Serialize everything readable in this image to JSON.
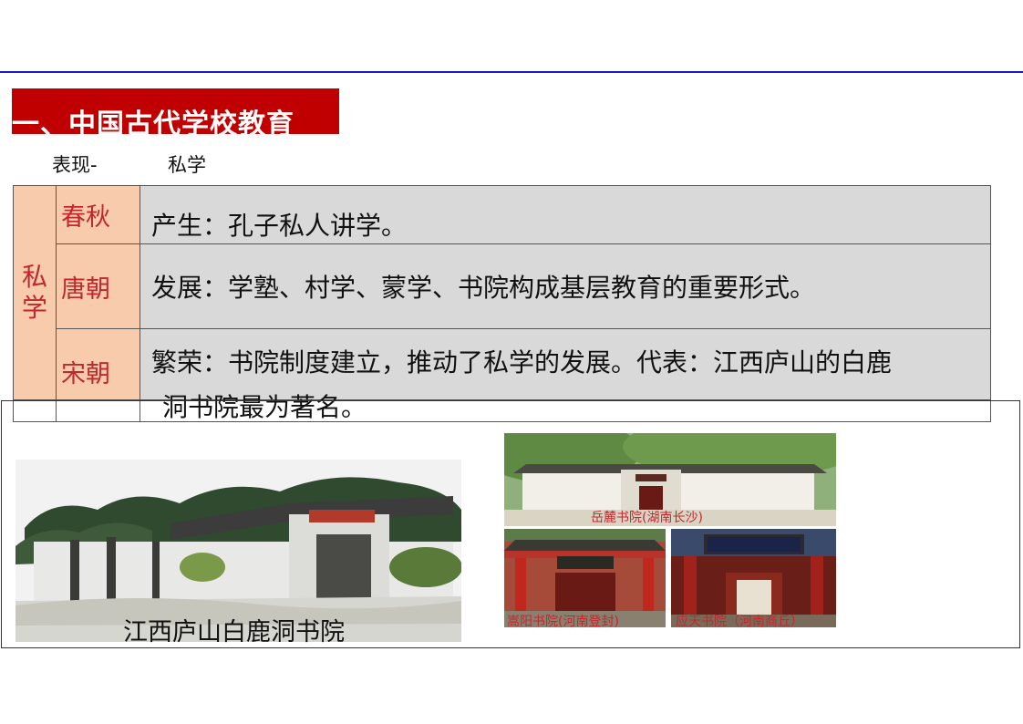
{
  "header": {
    "title": "一、中国古代学校教育"
  },
  "subhead": {
    "label": "表现-",
    "value": "私学"
  },
  "table": {
    "category": "私学",
    "rows": [
      {
        "era": "春秋",
        "desc": "产生：孔子私人讲学。"
      },
      {
        "era": "唐朝",
        "desc": "发展：学塾、村学、蒙学、书院构成基层教育的重要形式。"
      },
      {
        "era": "宋朝",
        "desc_line1": "繁荣：书院制度建立，推动了私学的发展。代表：江西庐山的白鹿",
        "desc_line2": "洞书院最为著名。"
      }
    ]
  },
  "images": {
    "bailudong": {
      "caption": "江西庐山白鹿洞书院"
    },
    "yuelu": {
      "caption": "岳麓书院(湖南长沙)"
    },
    "songyang": {
      "caption": "嵩阳书院(河南登封)"
    },
    "yingtian": {
      "caption": "应天书院（河南商丘）"
    }
  },
  "colors": {
    "title_bg": "#c00000",
    "era_bg": "#f8cbad",
    "era_text": "#c0282d",
    "desc_bg": "#d9d9d9",
    "rule": "#1a1acc"
  }
}
